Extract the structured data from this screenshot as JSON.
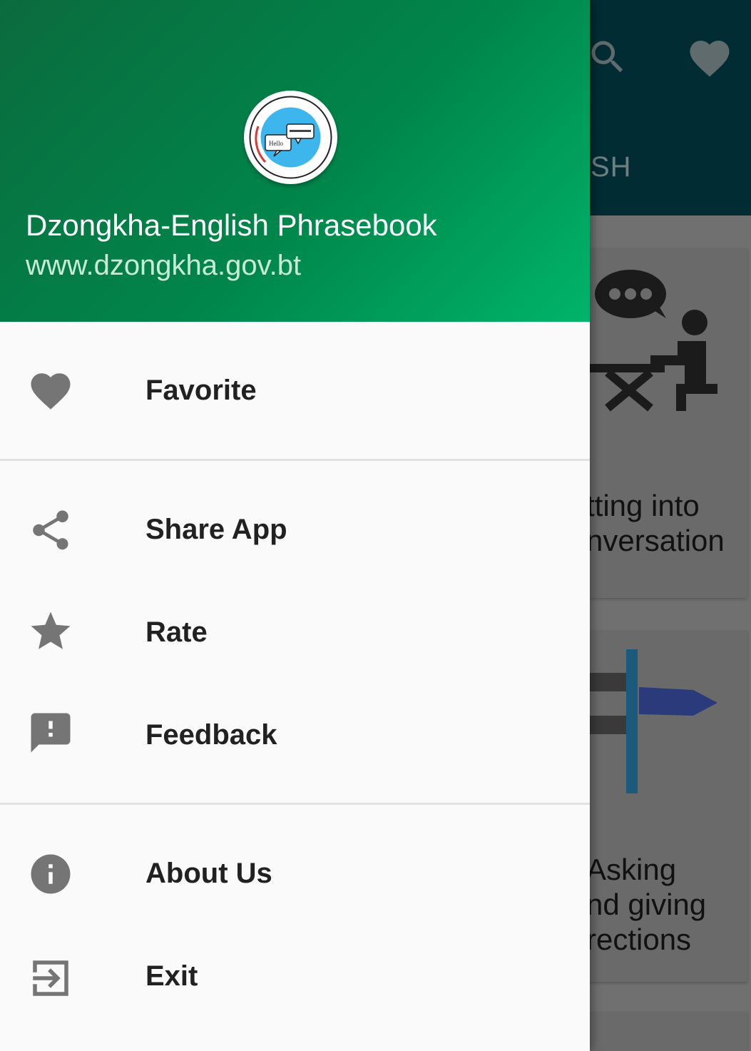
{
  "app": {
    "title": "Dzongkha-English Phrasebook",
    "url": "www.dzongkha.gov.bt",
    "logo_text": "Hello"
  },
  "background": {
    "tab_partial": "SH",
    "cards": [
      {
        "label_line1": "tting into",
        "label_line2": "nversation"
      },
      {
        "label_line1": "Asking",
        "label_line2": "nd giving",
        "label_line3": "rections"
      }
    ]
  },
  "menu": {
    "favorite": {
      "label": "Favorite",
      "icon": "heart-icon"
    },
    "share": {
      "label": "Share App",
      "icon": "share-icon"
    },
    "rate": {
      "label": "Rate",
      "icon": "star-icon"
    },
    "feedback": {
      "label": "Feedback",
      "icon": "feedback-icon"
    },
    "about": {
      "label": "About Us",
      "icon": "info-icon"
    },
    "exit": {
      "label": "Exit",
      "icon": "exit-icon"
    }
  },
  "colors": {
    "header_start": "#0b6b3e",
    "header_end": "#00b46a",
    "icon_gray": "#757575",
    "text_dark": "#212121"
  }
}
